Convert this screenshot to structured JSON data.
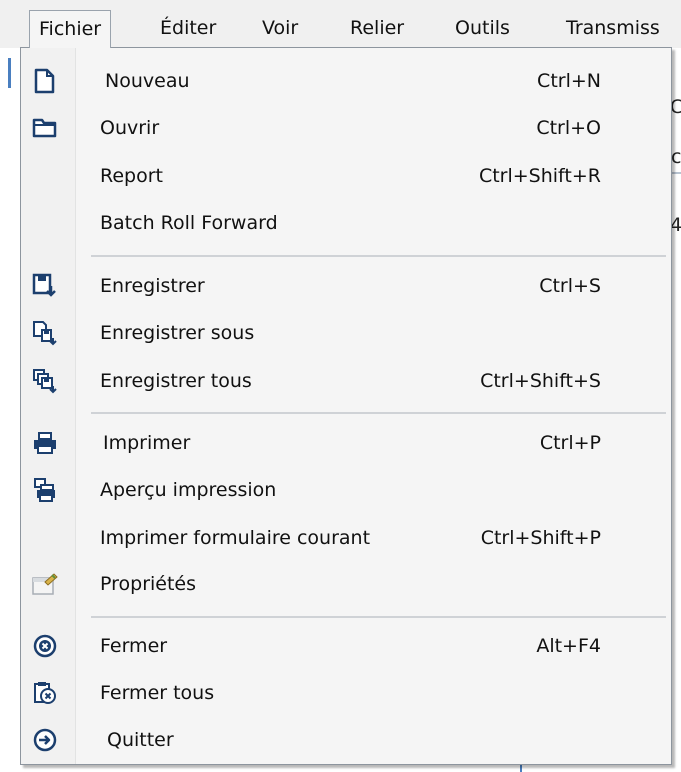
{
  "menubar": {
    "items": [
      {
        "label": "Fichier"
      },
      {
        "label": "Éditer"
      },
      {
        "label": "Voir"
      },
      {
        "label": "Relier"
      },
      {
        "label": "Outils"
      },
      {
        "label": "Transmiss"
      }
    ]
  },
  "dropdown": {
    "items": [
      {
        "label": "Nouveau",
        "shortcut": "Ctrl+N",
        "icon": "new-document-icon"
      },
      {
        "label": "Ouvrir",
        "shortcut": "Ctrl+O",
        "icon": "open-folder-icon"
      },
      {
        "label": "Report",
        "shortcut": "Ctrl+Shift+R",
        "icon": ""
      },
      {
        "label": "Batch Roll Forward",
        "shortcut": "",
        "icon": ""
      },
      {
        "label": "Enregistrer",
        "shortcut": "Ctrl+S",
        "icon": "save-icon"
      },
      {
        "label": "Enregistrer sous",
        "shortcut": "",
        "icon": "save-as-icon"
      },
      {
        "label": "Enregistrer tous",
        "shortcut": "Ctrl+Shift+S",
        "icon": "save-all-icon"
      },
      {
        "label": "Imprimer",
        "shortcut": "Ctrl+P",
        "icon": "printer-icon"
      },
      {
        "label": "Aperçu impression",
        "shortcut": "",
        "icon": "print-preview-icon"
      },
      {
        "label": "Imprimer formulaire courant",
        "shortcut": "Ctrl+Shift+P",
        "icon": ""
      },
      {
        "label": "Propriétés",
        "shortcut": "",
        "icon": "properties-icon"
      },
      {
        "label": "Fermer",
        "shortcut": "Alt+F4",
        "icon": "close-circle-icon"
      },
      {
        "label": "Fermer tous",
        "shortcut": "",
        "icon": "close-all-icon"
      },
      {
        "label": "Quitter",
        "shortcut": "",
        "icon": "exit-arrow-icon"
      }
    ]
  },
  "background": {
    "partial_text_1": "C",
    "partial_text_2": "c",
    "partial_text_3": "4"
  },
  "colors": {
    "icon_blue": "#1c4f8c",
    "menu_bg": "#f5f5f5",
    "separator": "#cfd2d6"
  }
}
